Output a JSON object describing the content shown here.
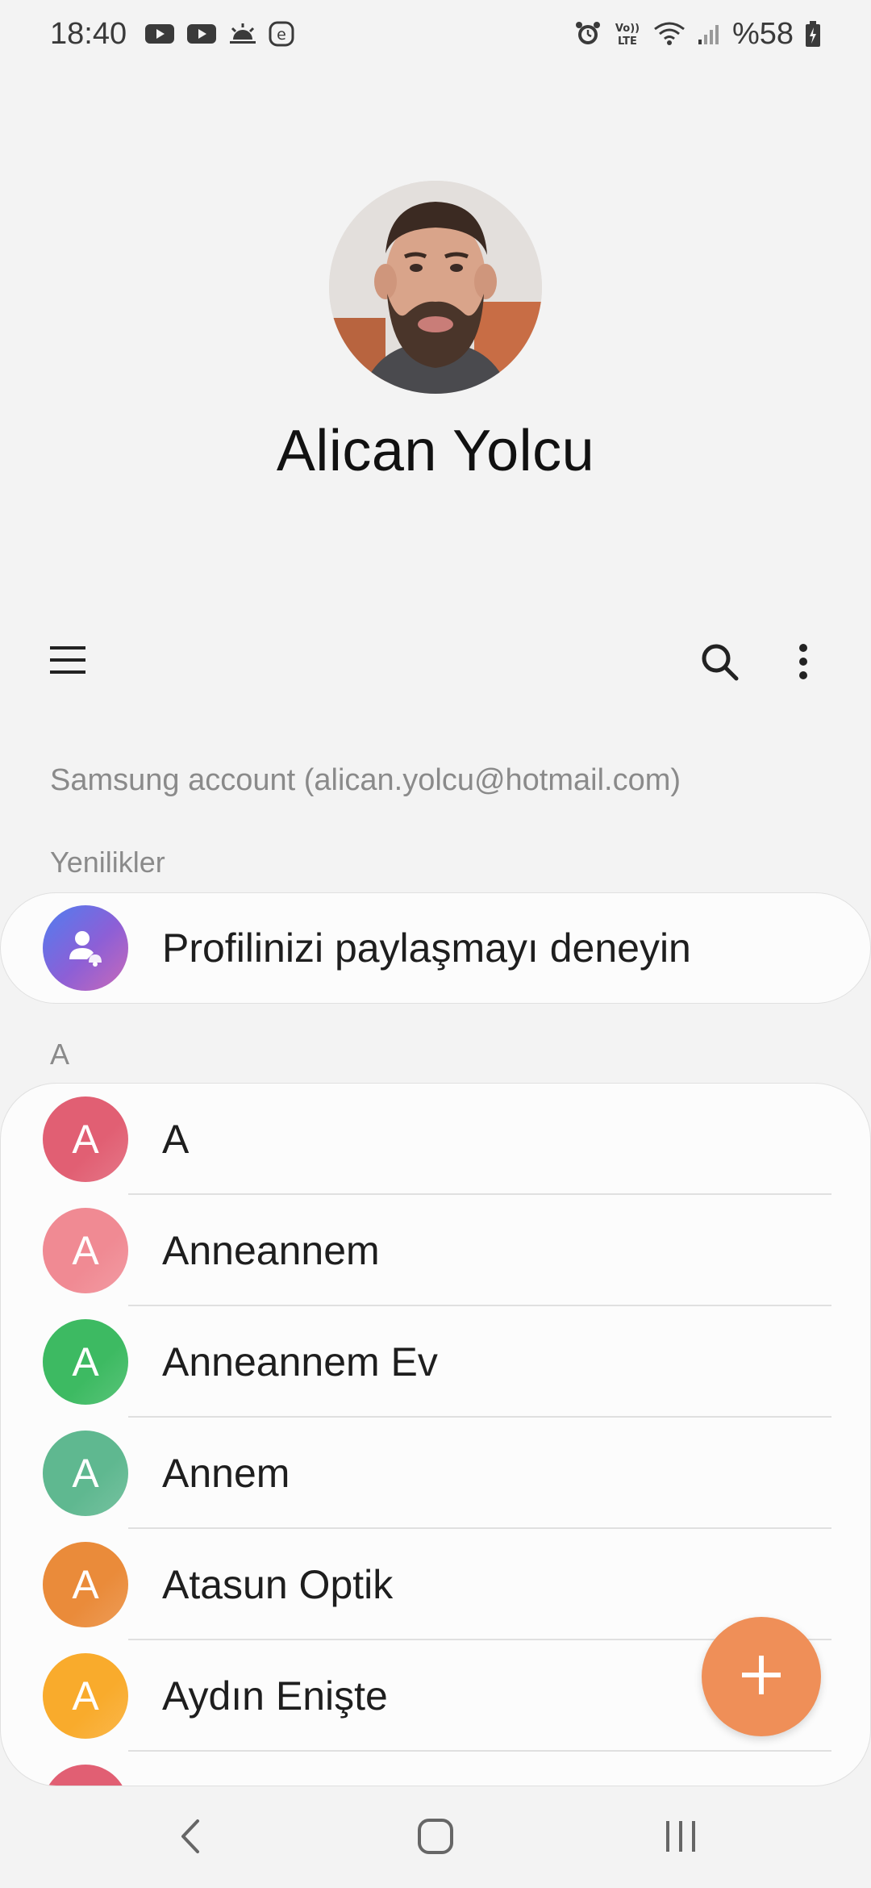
{
  "status_bar": {
    "time": "18:40",
    "battery": "%58",
    "left_icons": [
      "youtube-icon",
      "youtube-icon",
      "weather-icon",
      "e-app-icon"
    ],
    "right_icons": [
      "alarm-icon",
      "volte-icon",
      "wifi-icon",
      "signal-icon",
      "battery-icon"
    ],
    "volte_text": "Vo)) LTE"
  },
  "profile": {
    "name": "Alican Yolcu"
  },
  "toolbar": {
    "menu_icon": "menu-icon",
    "search_icon": "search-icon",
    "more_icon": "more-vert-icon"
  },
  "account": {
    "label": "Samsung account (alican.yolcu@hotmail.com)"
  },
  "whats_new": {
    "header": "Yenilikler",
    "item": "Profilinizi paylaşmayı deneyin"
  },
  "contacts": {
    "section": "A",
    "items": [
      {
        "initial": "A",
        "name": "A",
        "color": "#e15f73"
      },
      {
        "initial": "A",
        "name": "Anneannem",
        "color": "#f08a93"
      },
      {
        "initial": "A",
        "name": "Anneannem Ev",
        "color": "#3dba62"
      },
      {
        "initial": "A",
        "name": "Annem",
        "color": "#5fb890"
      },
      {
        "initial": "A",
        "name": "Atasun Optik",
        "color": "#ea8b3a"
      },
      {
        "initial": "A",
        "name": "Aydın Enişte",
        "color": "#f9ab2c"
      },
      {
        "initial": "",
        "name": "",
        "color": "#e15f73"
      }
    ]
  },
  "fab": {
    "icon": "plus-icon",
    "color": "#ef8f58"
  },
  "nav": {
    "back_icon": "back-icon",
    "home_icon": "home-icon",
    "recents_icon": "recents-icon"
  }
}
